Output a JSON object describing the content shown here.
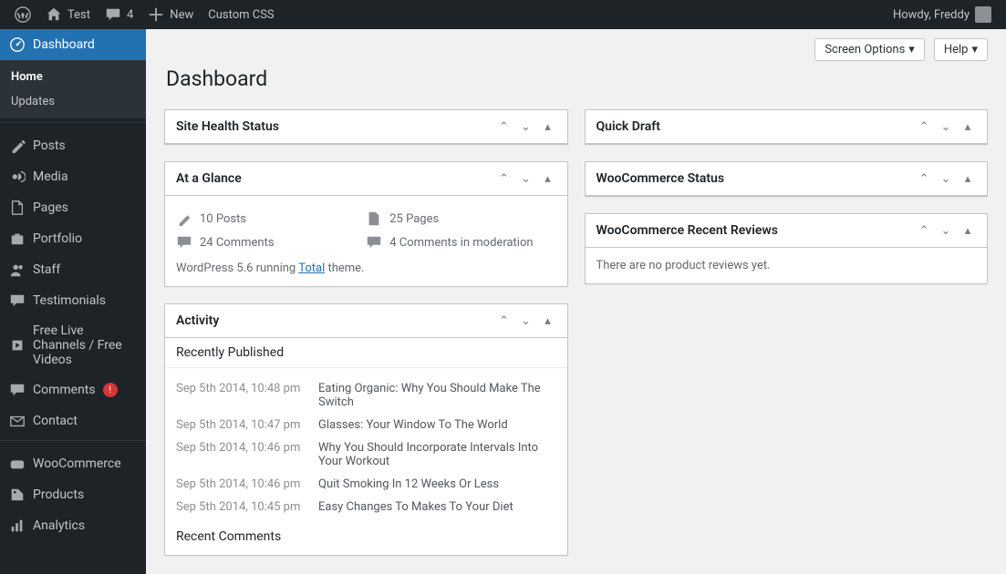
{
  "adminbar": {
    "site": "Test",
    "comments_count": "4",
    "new": "New",
    "custom_css": "Custom CSS",
    "howdy": "Howdy, Freddy"
  },
  "sidebar": {
    "dashboard": "Dashboard",
    "submenu": {
      "home": "Home",
      "updates": "Updates"
    },
    "posts": "Posts",
    "media": "Media",
    "pages": "Pages",
    "portfolio": "Portfolio",
    "staff": "Staff",
    "testimonials": "Testimonials",
    "free_live": "Free Live Channels / Free Videos",
    "comments": "Comments",
    "contact": "Contact",
    "woocommerce": "WooCommerce",
    "products": "Products",
    "analytics": "Analytics"
  },
  "page": {
    "title": "Dashboard",
    "screen_options": "Screen Options",
    "help": "Help"
  },
  "widgets": {
    "site_health": "Site Health Status",
    "glance": {
      "title": "At a Glance",
      "posts": "10 Posts",
      "pages": "25 Pages",
      "comments": "24 Comments",
      "moderation": "4 Comments in moderation",
      "version_pre": "WordPress 5.6 running ",
      "theme": "Total",
      "version_post": " theme."
    },
    "activity": {
      "title": "Activity",
      "recently_published": "Recently Published",
      "items": [
        {
          "date": "Sep 5th 2014, 10:48 pm",
          "title": "Eating Organic: Why You Should Make The Switch"
        },
        {
          "date": "Sep 5th 2014, 10:47 pm",
          "title": "Glasses: Your Window To The World"
        },
        {
          "date": "Sep 5th 2014, 10:46 pm",
          "title": "Why You Should Incorporate Intervals Into Your Workout"
        },
        {
          "date": "Sep 5th 2014, 10:46 pm",
          "title": "Quit Smoking In 12 Weeks Or Less"
        },
        {
          "date": "Sep 5th 2014, 10:45 pm",
          "title": "Easy Changes To Makes To Your Diet"
        }
      ],
      "recent_comments": "Recent Comments"
    },
    "quick_draft": "Quick Draft",
    "woo_status": "WooCommerce Status",
    "woo_reviews": {
      "title": "WooCommerce Recent Reviews",
      "empty": "There are no product reviews yet."
    }
  }
}
